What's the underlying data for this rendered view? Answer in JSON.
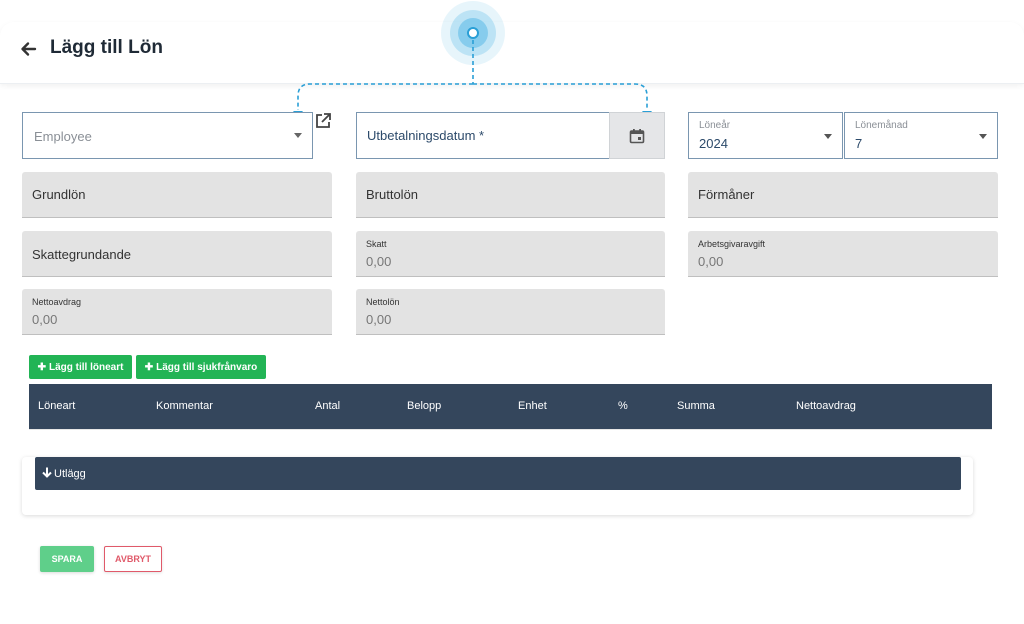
{
  "header": {
    "title": "Lägg till Lön"
  },
  "form": {
    "employee_placeholder": "Employee",
    "payment_date_label": "Utbetalningsdatum *",
    "year_label": "Löneår",
    "year_value": "2024",
    "month_label": "Lönemånad",
    "month_value": "7"
  },
  "summary": {
    "grundlon": "Grundlön",
    "bruttolon": "Bruttolön",
    "formaner": "Förmåner",
    "skattegrundande": "Skattegrundande",
    "skatt_label": "Skatt",
    "skatt_value": "0,00",
    "arbetsgivaravgift_label": "Arbetsgivaravgift",
    "arbetsgivaravgift_value": "0,00",
    "nettoavdrag_label": "Nettoavdrag",
    "nettoavdrag_value": "0,00",
    "nettolon_label": "Nettolön",
    "nettolon_value": "0,00"
  },
  "actions": {
    "add_loneart": "Lägg till löneart",
    "add_sjukfranvaro": "Lägg till sjukfrånvaro"
  },
  "table": {
    "columns": [
      "Löneart",
      "Kommentar",
      "Antal",
      "Belopp",
      "Enhet",
      "%",
      "Summa",
      "Nettoavdrag"
    ]
  },
  "utlagg": {
    "label": "Utlägg"
  },
  "footer": {
    "save": "SPARA",
    "cancel": "AVBRYT"
  },
  "colors": {
    "header_dark": "#34465c",
    "green": "#22b455",
    "save_green": "#5fcf8a",
    "cancel_red": "#e05a6a",
    "highlight_blue": "#2a9fd6"
  }
}
